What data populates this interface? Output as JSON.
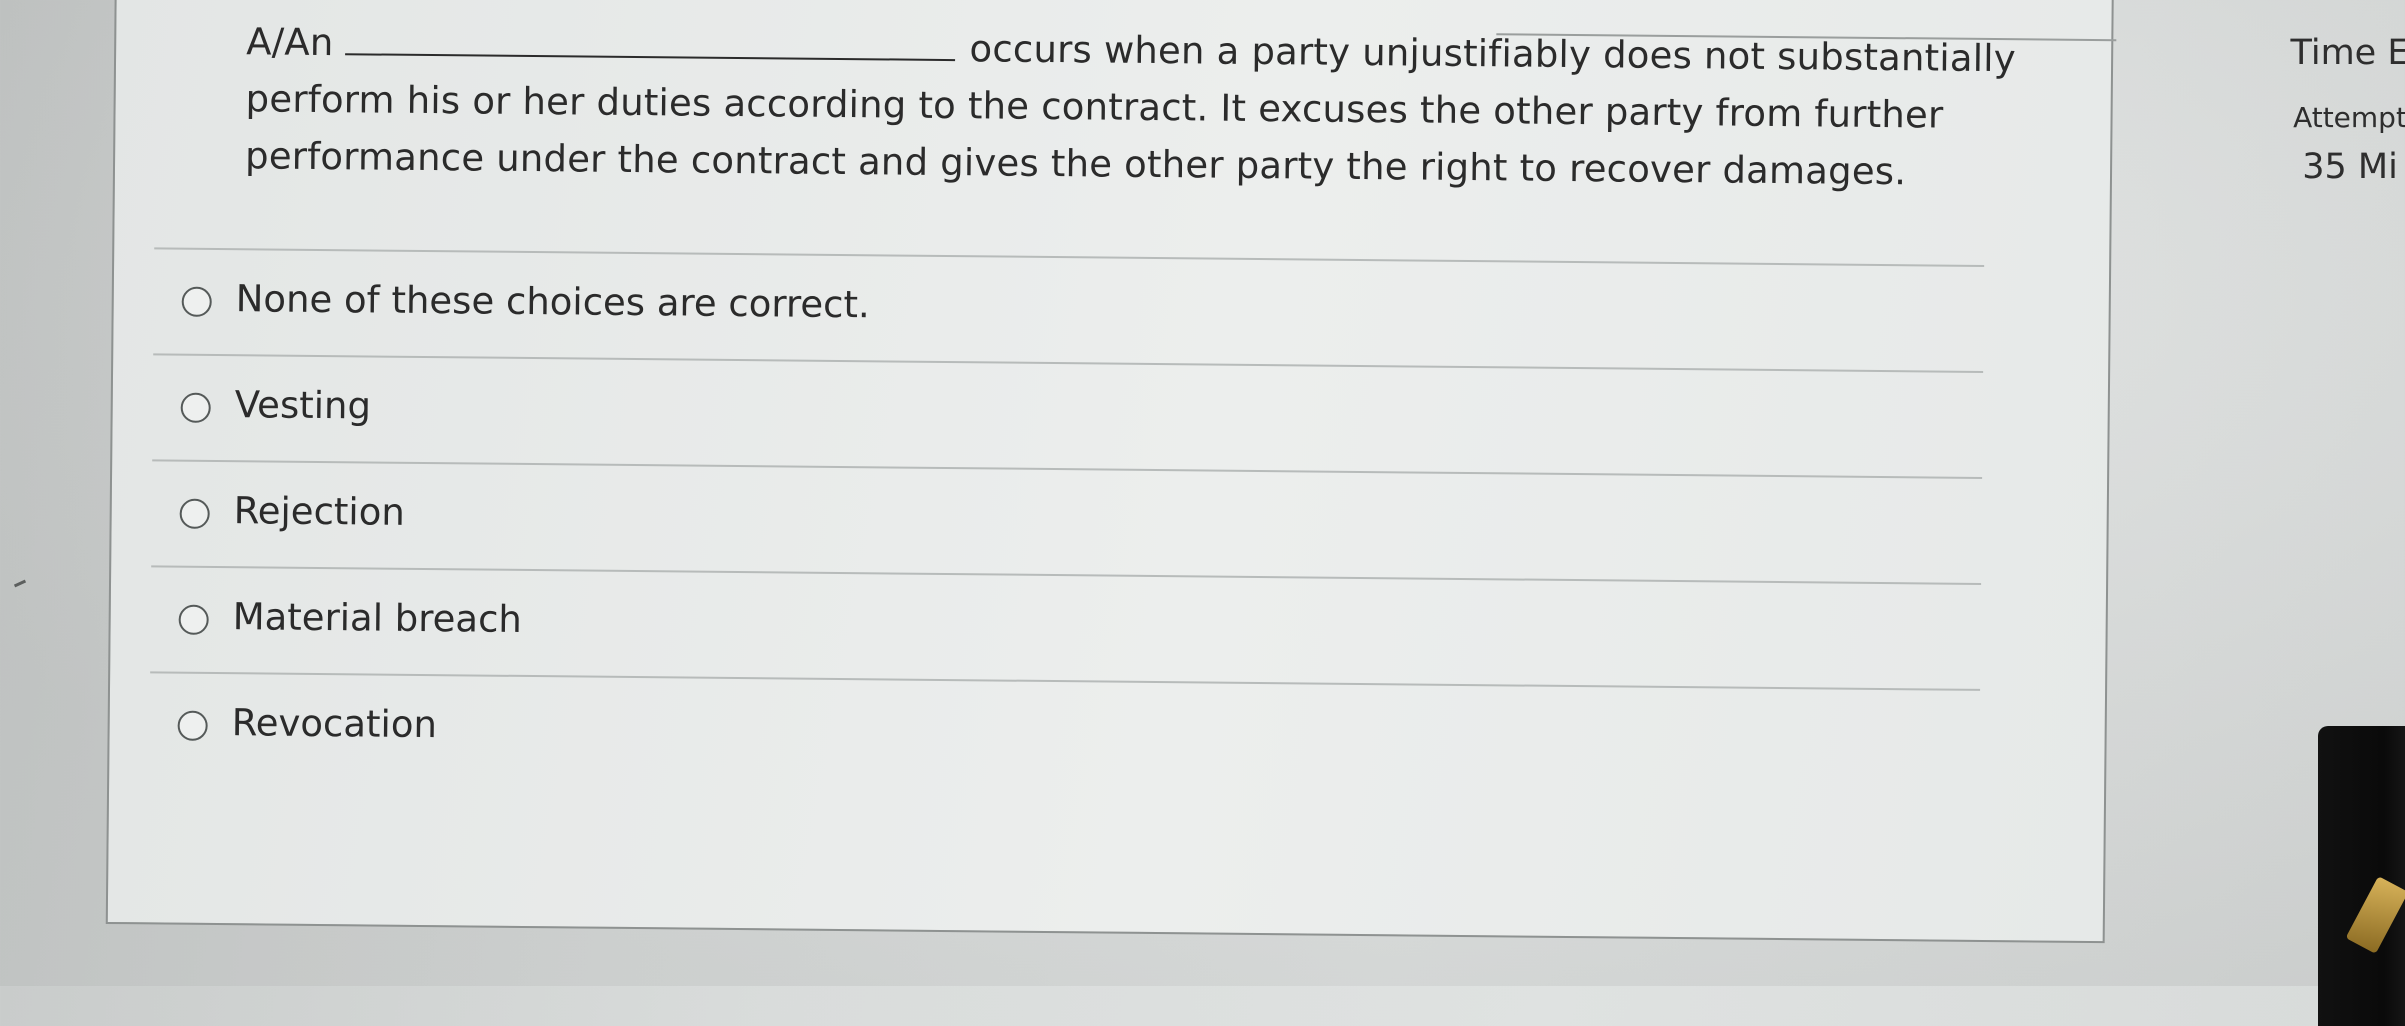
{
  "question": {
    "stem_prefix": "A/An",
    "stem_suffix": "occurs when a party unjustifiably does not substantially perform his or her duties according to the contract. It excuses the other party from further performance under the contract and gives the other party the right to recover damages."
  },
  "options": [
    {
      "label": "None of these choices are correct.",
      "selected": false
    },
    {
      "label": "Vesting",
      "selected": false
    },
    {
      "label": "Rejection",
      "selected": false
    },
    {
      "label": "Material breach",
      "selected": false
    },
    {
      "label": "Revocation",
      "selected": false
    }
  ],
  "side_panel": {
    "time_label": "Time E",
    "attempt_label": "Attempt",
    "minutes_label": "35 Mi"
  },
  "colors": {
    "text": "#2b2b2b",
    "panel_border": "#8e9291",
    "divider": "#b7bbba",
    "radio_border": "#555a59"
  }
}
